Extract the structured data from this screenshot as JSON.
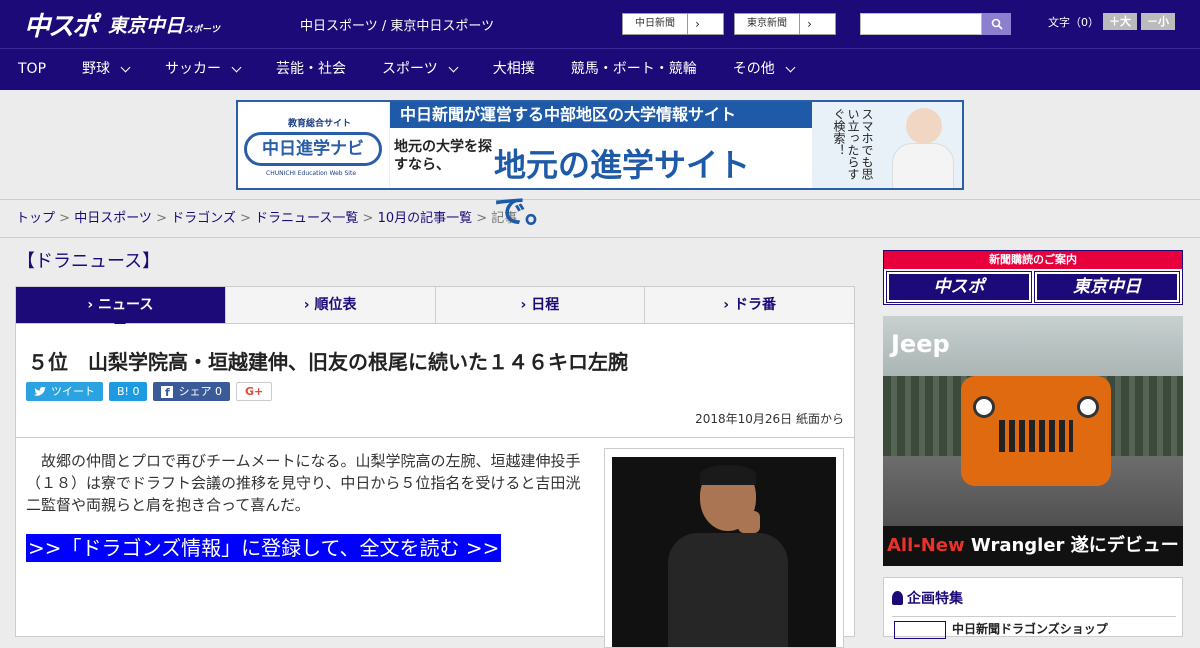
{
  "header": {
    "logo_main": "中スポ",
    "logo_tokyo": "東京中日",
    "logo_tokyo_small": "スポーツ",
    "site_name": "中日スポーツ / 東京中日スポーツ",
    "buttons": [
      {
        "label": "中日新聞",
        "chevron": "›"
      },
      {
        "label": "東京新聞",
        "chevron": "›"
      }
    ],
    "search_placeholder": "",
    "font_size_label": "文字（0）",
    "font_plus": "＋大",
    "font_minus": "－小"
  },
  "nav": {
    "items": [
      {
        "label": "TOP",
        "dropdown": false
      },
      {
        "label": "野球",
        "dropdown": true
      },
      {
        "label": "サッカー",
        "dropdown": true
      },
      {
        "label": "芸能・社会",
        "dropdown": false
      },
      {
        "label": "スポーツ",
        "dropdown": true
      },
      {
        "label": "大相撲",
        "dropdown": false
      },
      {
        "label": "競馬・ボート・競輪",
        "dropdown": false
      },
      {
        "label": "その他",
        "dropdown": true
      }
    ]
  },
  "banner": {
    "sub": "教育総合サイト",
    "logo": "中日進学ナビ",
    "en": "CHUNICHI Education Web Site",
    "headline": "中日新聞が運営する中部地区の大学情報サイト",
    "small": "地元の大学を探すなら、",
    "big": "地元の進学サイトで。",
    "vertical": "スマホでも思い立ったらすぐ検索！"
  },
  "breadcrumb": {
    "items": [
      "トップ",
      "中日スポーツ",
      "ドラゴンズ",
      "ドラニュース一覧",
      "10月の記事一覧"
    ],
    "separator": " > ",
    "current": "記事"
  },
  "article": {
    "category": "【ドラニュース】",
    "tabs": [
      {
        "label": "ニュース",
        "active": true
      },
      {
        "label": "順位表",
        "active": false
      },
      {
        "label": "日程",
        "active": false
      },
      {
        "label": "ドラ番",
        "active": false
      }
    ],
    "title": "５位　山梨学院高・垣越建伸、旧友の根尾に続いた１４６キロ左腕",
    "share": {
      "tweet": "ツイート",
      "hatena": "B! 0",
      "facebook": "シェア 0",
      "gplus": "G+"
    },
    "date": "2018年10月26日 紙面から",
    "body": "　故郷の仲間とプロで再びチームメートになる。山梨学院高の左腕、垣越建伸投手（１８）は寮でドラフト会議の推移を見守り、中日から５位指名を受けると吉田洸二監督や両親らと肩を抱き合って喜んだ。",
    "read_more": ">>「ドラゴンズ情報」に登録して、全文を読む >>"
  },
  "sidebar": {
    "subscribe_header": "新聞購読のご案内",
    "subscribe_buttons": [
      "中スポ",
      "東京中日"
    ],
    "ad_brand": "Jeep",
    "ad_caption_red": "All-New",
    "ad_caption": " Wrangler 遂にデビュー",
    "feature_title": "企画特集",
    "feature_item": "中日新聞ドラゴンズショップ"
  }
}
